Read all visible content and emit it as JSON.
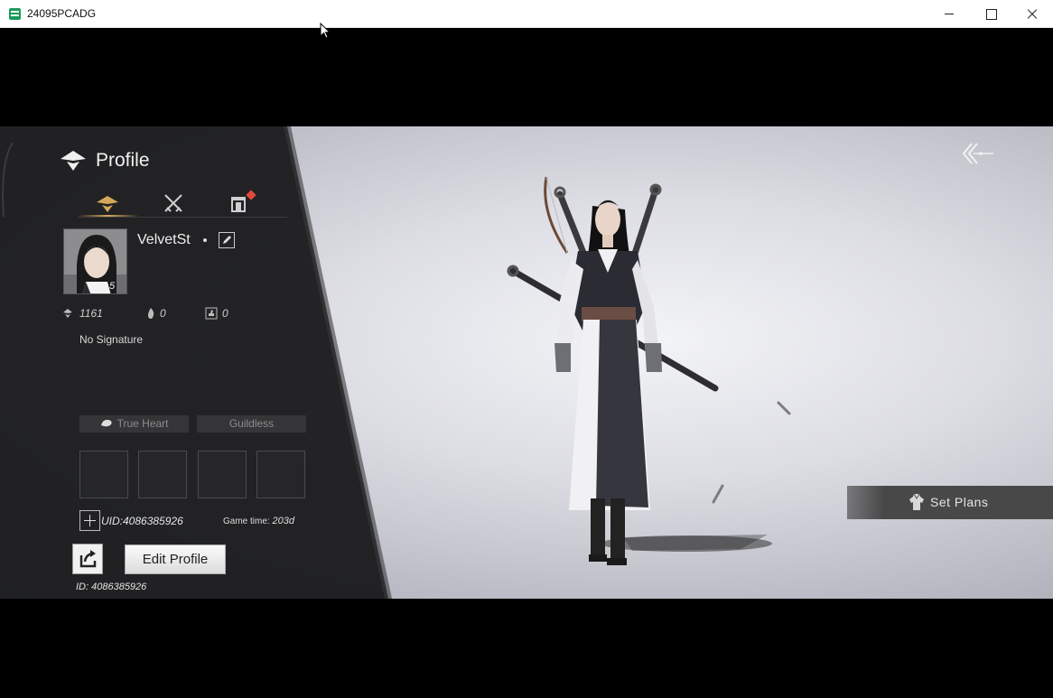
{
  "window": {
    "title": "24095PCADG",
    "minimize_icon": "minimize-icon",
    "maximize_icon": "maximize-icon",
    "close_icon": "close-icon"
  },
  "profile": {
    "page_title": "Profile",
    "tabs": [
      {
        "icon": "profile-emblem-icon",
        "active": true
      },
      {
        "icon": "crossed-swords-icon",
        "active": false
      },
      {
        "icon": "house-icon",
        "active": false,
        "notification": true
      }
    ],
    "player": {
      "name": "VelvetSt",
      "avatar_level": "5",
      "edit_icon": "pencil-icon"
    },
    "stats": [
      {
        "icon": "emblem-icon",
        "value": "1161"
      },
      {
        "icon": "flame-icon",
        "value": "0"
      },
      {
        "icon": "thumbs-up-icon",
        "value": "0"
      }
    ],
    "signature": "No Signature",
    "tags": {
      "relationship": "True Heart",
      "guild": "Guildless"
    },
    "slot_count": 4,
    "uid_text": "UID:4086385926",
    "game_time_label": "Game time: ",
    "game_time_value": "203d",
    "edit_profile_label": "Edit Profile",
    "id_text": "ID: 4086385926"
  },
  "scene": {
    "set_plans_label": "Set Plans",
    "back_icon": "back-arrows-icon"
  },
  "colors": {
    "accent_gold": "#d4a85a",
    "notification_red": "#e04a3c",
    "panel_dark": "#1e1e1e"
  }
}
